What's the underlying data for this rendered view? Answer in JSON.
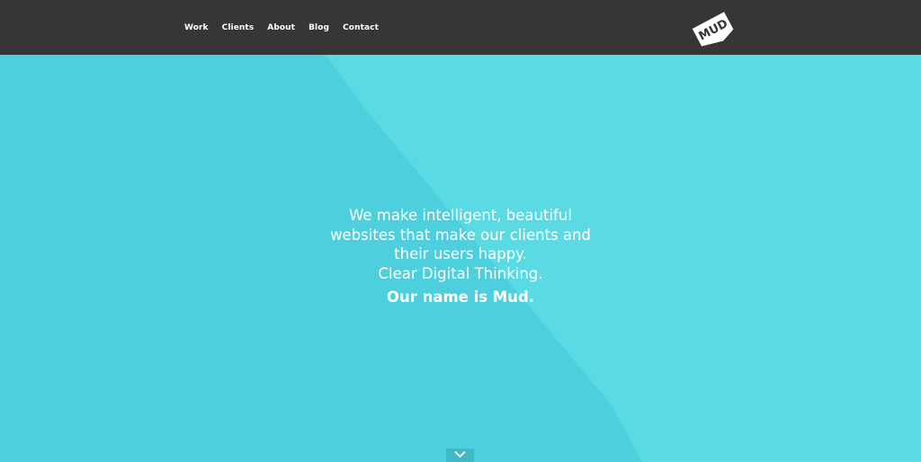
{
  "header": {
    "nav": [
      {
        "label": "Work"
      },
      {
        "label": "Clients"
      },
      {
        "label": "About"
      },
      {
        "label": "Blog"
      },
      {
        "label": "Contact"
      }
    ],
    "logo_text": "MUD",
    "logo_icon": "mud-logo-icon"
  },
  "hero": {
    "tagline_lines": [
      "We make intelligent, beautiful",
      "websites that make our clients and",
      "their users happy.",
      "Clear Digital Thinking."
    ],
    "tagline_strong": "Our name is Mud.",
    "scroll_icon": "chevron-down-icon"
  },
  "colors": {
    "topbar": "#363636",
    "hero_dark": "#4ecfdd",
    "hero_light": "#5adbe3",
    "text": "#ffffff",
    "scroll_button": "#3fb9c5"
  }
}
